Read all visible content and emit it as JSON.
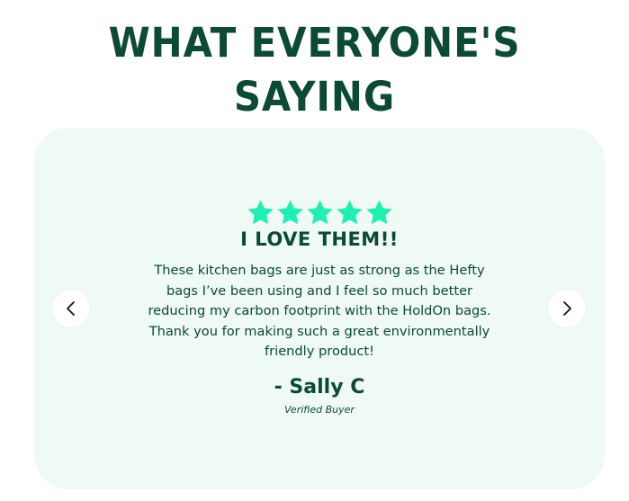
{
  "section": {
    "heading": "WHAT EVERYONE'S SAYING"
  },
  "review": {
    "rating": 5,
    "rating_max": 5,
    "star_color": "#1ef0b4",
    "title": "I LOVE THEM!!",
    "body": "These kitchen bags are just as strong as the Hefty bags I’ve been using and I feel so much better reducing my carbon footprint with the HoldOn bags. Thank you for making such a great environmentally friendly product!",
    "author": "- Sally C",
    "badge": "Verified Buyer"
  },
  "navigation": {
    "prev_icon": "chevron-left-icon",
    "next_icon": "chevron-right-icon"
  },
  "colors": {
    "text": "#0b4a35",
    "card_background": "#eefaf3",
    "button_background": "#ffffff"
  }
}
